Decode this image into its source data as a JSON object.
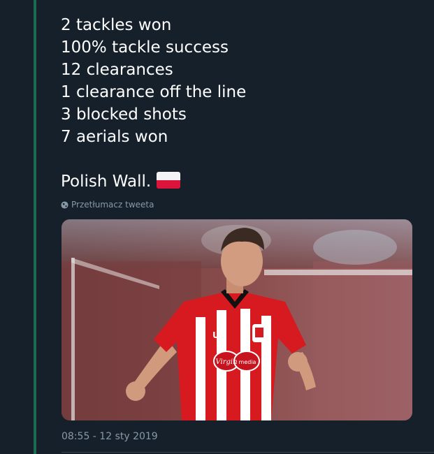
{
  "tweet": {
    "lines": [
      "2 tackles won",
      "100% tackle success",
      "12 clearances",
      "1 clearance off the line",
      "3 blocked shots",
      "7 aerials won"
    ],
    "closing": "Polish Wall.",
    "flag_icon": "poland-flag-icon",
    "translate_label": "Przetłumacz tweeta",
    "timestamp": "08:55 - 12 sty 2019",
    "media": {
      "sponsor_text": "Virgin media",
      "kit_colors": {
        "red": "#d71920",
        "white": "#ffffff",
        "black": "#111111"
      }
    }
  },
  "colors": {
    "background": "#15202b",
    "thread_line": "#1a6b4f",
    "text": "#ffffff",
    "muted": "#8899a6"
  }
}
